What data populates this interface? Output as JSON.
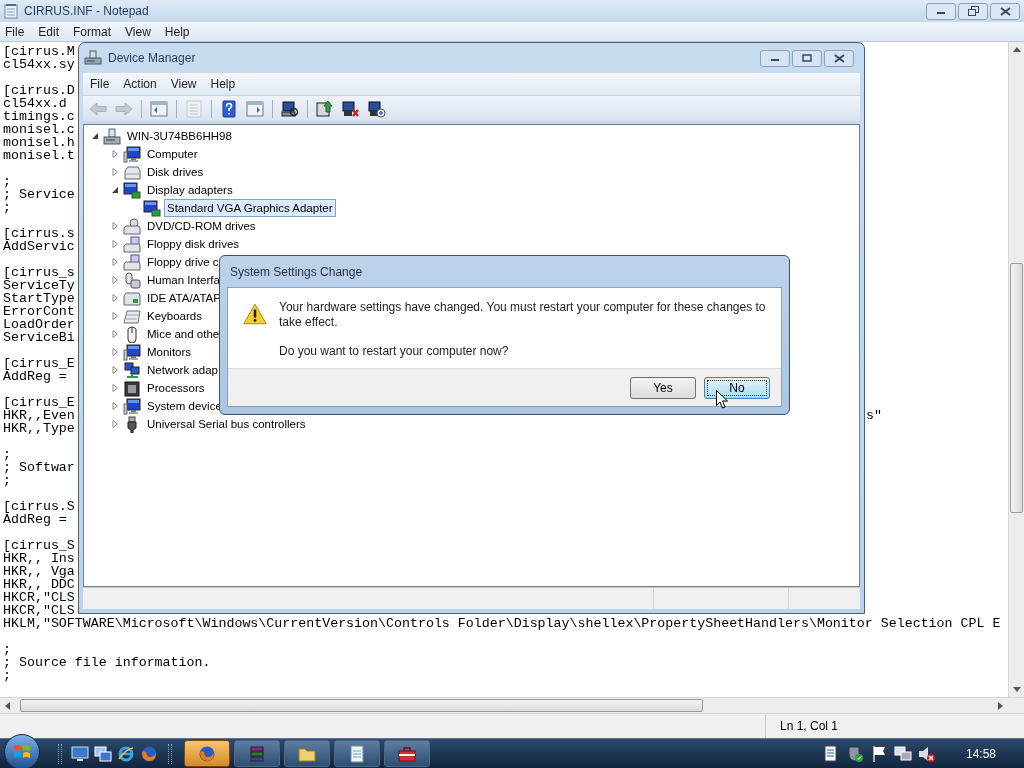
{
  "notepad": {
    "title": "CIRRUS.INF - Notepad",
    "menu": [
      "File",
      "Edit",
      "Format",
      "View",
      "Help"
    ],
    "text_blocks": [
      [
        "[cirrus.M",
        "cl54xx.sy"
      ],
      [
        "[cirrus.D",
        "cl54xx.d",
        "timings.c",
        "monisel.c",
        "monisel.h",
        "monisel.t"
      ],
      [
        ";",
        "; Service",
        ";"
      ],
      [
        "[cirrus.s",
        "AddServic"
      ],
      [
        "[cirrus_s",
        "ServiceTy",
        "StartType",
        "ErrorCont",
        "LoadOrder",
        "ServiceBi"
      ],
      [
        "[cirrus_E",
        "AddReg ="
      ],
      [
        "[cirrus_E",
        {
          "text": "HKR,,Even",
          "tail": "s\""
        },
        "HKR,,Type"
      ],
      [
        ";",
        "; Softwar",
        ";"
      ],
      [
        "[cirrus.S",
        "AddReg ="
      ],
      [
        "[cirrus_S",
        "HKR,, Ins",
        "HKR,, Vga",
        "HKR,, DDC",
        "HKCR,\"CLS",
        "HKCR,\"CLS",
        "HKLM,\"SOFTWARE\\Microsoft\\Windows\\CurrentVersion\\Controls Folder\\Display\\shellex\\PropertySheetHandlers\\Monitor Selection CPL E"
      ],
      [
        ";",
        "; Source file information.",
        ";"
      ]
    ],
    "status": "Ln 1, Col 1"
  },
  "device_manager": {
    "title": "Device Manager",
    "menu": [
      "File",
      "Action",
      "View",
      "Help"
    ],
    "toolbar": [
      [
        {
          "kind": "back",
          "disabled": true
        },
        {
          "kind": "forward",
          "disabled": true
        }
      ],
      [
        {
          "kind": "console-tree",
          "disabled": false
        }
      ],
      [
        {
          "kind": "properties",
          "disabled": true
        }
      ],
      [
        {
          "kind": "help",
          "disabled": false
        },
        {
          "kind": "action-pane",
          "disabled": false
        }
      ],
      [
        {
          "kind": "scan",
          "disabled": false
        }
      ],
      [
        {
          "kind": "update",
          "disabled": false
        },
        {
          "kind": "uninstall",
          "disabled": false
        },
        {
          "kind": "disable",
          "disabled": false
        }
      ]
    ],
    "tree": [
      {
        "label": "WIN-3U74BB6HH98",
        "kind": "host",
        "expanded": true,
        "selected": false,
        "children": [
          {
            "label": "Computer",
            "kind": "computer",
            "expanded": false,
            "selected": false
          },
          {
            "label": "Disk drives",
            "kind": "disk",
            "expanded": false,
            "selected": false
          },
          {
            "label": "Display adapters",
            "kind": "display",
            "expanded": true,
            "selected": false,
            "children": [
              {
                "label": "Standard VGA Graphics Adapter",
                "kind": "display",
                "selected": true
              }
            ]
          },
          {
            "label": "DVD/CD-ROM drives",
            "kind": "dvd",
            "expanded": false,
            "selected": false
          },
          {
            "label": "Floppy disk drives",
            "kind": "floppy",
            "expanded": false,
            "selected": false
          },
          {
            "label": "Floppy drive c",
            "kind": "floppy",
            "expanded": false,
            "selected": false
          },
          {
            "label": "Human Interfa",
            "kind": "hid",
            "expanded": false,
            "selected": false
          },
          {
            "label": "IDE ATA/ATAP",
            "kind": "ide",
            "expanded": false,
            "selected": false
          },
          {
            "label": "Keyboards",
            "kind": "keyboard",
            "expanded": false,
            "selected": false
          },
          {
            "label": "Mice and othe",
            "kind": "mouse",
            "expanded": false,
            "selected": false
          },
          {
            "label": "Monitors",
            "kind": "computer",
            "expanded": false,
            "selected": false
          },
          {
            "label": "Network adap",
            "kind": "network",
            "expanded": false,
            "selected": false
          },
          {
            "label": "Processors",
            "kind": "cpu",
            "expanded": false,
            "selected": false
          },
          {
            "label": "System device",
            "kind": "computer",
            "expanded": false,
            "selected": false
          },
          {
            "label": "Universal Serial bus controllers",
            "kind": "usb",
            "expanded": false,
            "selected": false
          }
        ]
      }
    ]
  },
  "dialog": {
    "title": "System Settings Change",
    "message": "Your hardware settings have changed. You must restart your computer for these changes to take effect.",
    "question": "Do you want to restart your computer now?",
    "buttons": [
      {
        "label": "Yes",
        "highlighted": false
      },
      {
        "label": "No",
        "highlighted": true
      }
    ]
  },
  "taskbar": {
    "quick_launch": [
      {
        "kind": "desktop"
      },
      {
        "kind": "windows"
      },
      {
        "kind": "ie"
      },
      {
        "kind": "firefox"
      }
    ],
    "tasks": [
      {
        "kind": "firefox",
        "active": true
      },
      {
        "kind": "archive",
        "active": false
      },
      {
        "kind": "folder",
        "active": false
      },
      {
        "kind": "notepad",
        "active": false
      },
      {
        "kind": "toolbox",
        "active": false
      }
    ],
    "tray": [
      {
        "kind": "document"
      },
      {
        "kind": "shield"
      },
      {
        "kind": "flag"
      },
      {
        "kind": "network"
      },
      {
        "kind": "speaker-muted"
      }
    ],
    "clock": "14:58"
  }
}
